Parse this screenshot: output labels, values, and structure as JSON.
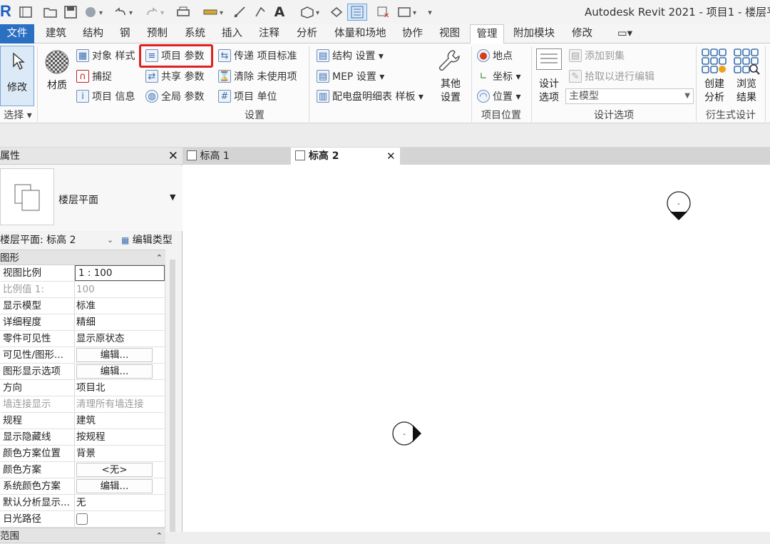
{
  "title_bar": {
    "logo": "R",
    "app_title": "Autodesk Revit 2021 - 项目1 - 楼层平面",
    "quick_access": [
      "open-icon",
      "save-icon",
      "sync-icon",
      "undo-icon",
      "redo-icon",
      "print-icon",
      "measure-icon",
      "dimension-icon",
      "tag-icon",
      "text-icon",
      "3d-view-icon",
      "section-icon",
      "thin-lines-icon",
      "close-hidden-icon",
      "switch-windows-icon",
      "customize-icon"
    ]
  },
  "tabs": [
    "文件",
    "建筑",
    "结构",
    "钢",
    "预制",
    "系统",
    "插入",
    "注释",
    "分析",
    "体量和场地",
    "协作",
    "视图",
    "管理",
    "附加模块",
    "修改",
    "▭▾"
  ],
  "active_tab": "管理",
  "ribbon": {
    "select": {
      "modify_label": "修改",
      "select_label": "选择 ▾"
    },
    "settings": {
      "materials": "材质",
      "object_styles": "对象 样式",
      "snaps": "捕捉",
      "project_info": "项目 信息",
      "project_parameters": "项目 参数",
      "shared_parameters": "共享 参数",
      "global_parameters": "全局 参数",
      "transfer_standards": "传递 项目标准",
      "purge_unused": "清除 未使用项",
      "project_units": "项目 单位",
      "structural_settings": "结构 设置 ▾",
      "mep_settings": "MEP 设置 ▾",
      "panel_schedule": "配电盘明细表 样板 ▾",
      "other_settings": "其他 设置",
      "panel_label": "设置"
    },
    "location": {
      "location": "地点",
      "coordinates": "坐标 ▾",
      "position": "位置 ▾",
      "panel_label": "项目位置"
    },
    "design_options": {
      "design_options": "设计 选项",
      "add_to_set": "添加到集",
      "pick_to_edit": "拾取以进行编辑",
      "main_model": "主模型",
      "panel_label": "设计选项"
    },
    "generative": {
      "create_study": "创建 分析",
      "explore": "浏览 结果",
      "panel_label": "衍生式设计"
    }
  },
  "properties": {
    "header": "属性",
    "type_name": "楼层平面",
    "selector": "楼层平面: 标高 2",
    "edit_type": "编辑类型",
    "category": "图形",
    "next_category": "范围",
    "rows": [
      {
        "key": "视图比例",
        "value": "1 : 100",
        "kind": "input"
      },
      {
        "key": "比例值 1:",
        "value": "100",
        "kind": "dim"
      },
      {
        "key": "显示模型",
        "value": "标准",
        "kind": "text"
      },
      {
        "key": "详细程度",
        "value": "精细",
        "kind": "text"
      },
      {
        "key": "零件可见性",
        "value": "显示原状态",
        "kind": "text"
      },
      {
        "key": "可见性/图形...",
        "value": "编辑...",
        "kind": "button"
      },
      {
        "key": "图形显示选项",
        "value": "编辑...",
        "kind": "button"
      },
      {
        "key": "方向",
        "value": "项目北",
        "kind": "text"
      },
      {
        "key": "墙连接显示",
        "value": "清理所有墙连接",
        "kind": "dim"
      },
      {
        "key": "规程",
        "value": "建筑",
        "kind": "text"
      },
      {
        "key": "显示隐藏线",
        "value": "按规程",
        "kind": "text"
      },
      {
        "key": "颜色方案位置",
        "value": "背景",
        "kind": "text"
      },
      {
        "key": "颜色方案",
        "value": "<无>",
        "kind": "button"
      },
      {
        "key": "系统颜色方案",
        "value": "编辑...",
        "kind": "button"
      },
      {
        "key": "默认分析显示...",
        "value": "无",
        "kind": "text"
      },
      {
        "key": "日光路径",
        "value": "",
        "kind": "checkbox"
      }
    ]
  },
  "views": {
    "tabs": [
      {
        "label": "标高 1"
      },
      {
        "label": "标高 2"
      }
    ],
    "active": 1,
    "close": "✕"
  },
  "canvas": {
    "marker_text": "-"
  }
}
